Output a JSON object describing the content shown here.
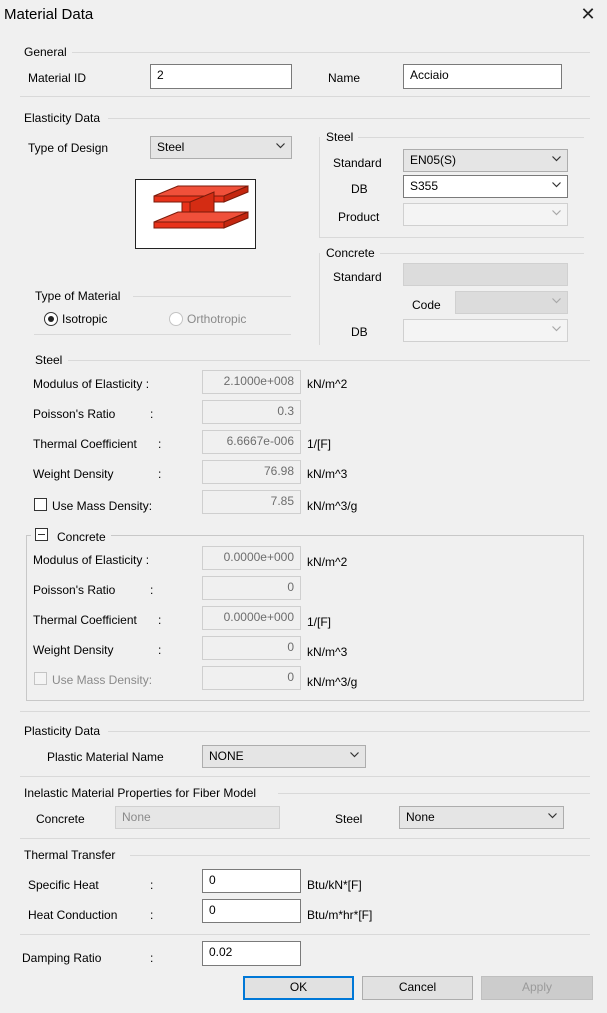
{
  "window": {
    "title": "Material Data"
  },
  "general": {
    "label": "General",
    "material_id_label": "Material ID",
    "material_id": "2",
    "name_label": "Name",
    "name": "Acciaio"
  },
  "elasticity": {
    "label": "Elasticity Data",
    "type_of_design_label": "Type of Design",
    "type_of_design": "Steel",
    "type_of_material": {
      "label": "Type of Material",
      "isotropic": "Isotropic",
      "orthotropic": "Orthotropic",
      "selected": "Isotropic"
    },
    "steel_group": {
      "label": "Steel",
      "standard_label": "Standard",
      "standard": "EN05(S)",
      "db_label": "DB",
      "db": "S355",
      "product_label": "Product",
      "product": ""
    },
    "concrete_group": {
      "label": "Concrete",
      "standard_label": "Standard",
      "standard": "",
      "code_label": "Code",
      "code": "",
      "db_label": "DB",
      "db": ""
    }
  },
  "steel_props": {
    "label": "Steel",
    "rows": [
      {
        "label": "Modulus of Elasticity :",
        "value": "2.1000e+008",
        "unit": "kN/m^2"
      },
      {
        "label": "Poisson's Ratio",
        "value": "0.3",
        "unit": ""
      },
      {
        "label": "Thermal Coefficient",
        "value": "6.6667e-006",
        "unit": "1/[F]"
      },
      {
        "label": "Weight Density",
        "value": "76.98",
        "unit": "kN/m^3"
      }
    ],
    "mass_density": {
      "label": "Use Mass Density:",
      "value": "7.85",
      "unit": "kN/m^3/g",
      "checked": false
    }
  },
  "concrete_props": {
    "label": "Concrete",
    "rows": [
      {
        "label": "Modulus of Elasticity :",
        "value": "0.0000e+000",
        "unit": "kN/m^2"
      },
      {
        "label": "Poisson's Ratio",
        "value": "0",
        "unit": ""
      },
      {
        "label": "Thermal Coefficient",
        "value": "0.0000e+000",
        "unit": "1/[F]"
      },
      {
        "label": "Weight Density",
        "value": "0",
        "unit": "kN/m^3"
      }
    ],
    "mass_density": {
      "label": "Use Mass Density:",
      "value": "0",
      "unit": "kN/m^3/g",
      "checked": false
    }
  },
  "plasticity": {
    "label": "Plasticity Data",
    "material_name_label": "Plastic Material Name",
    "material_name": "NONE"
  },
  "inelastic": {
    "label": "Inelastic Material Properties for Fiber Model",
    "concrete_label": "Concrete",
    "concrete": "None",
    "steel_label": "Steel",
    "steel": "None"
  },
  "thermal": {
    "label": "Thermal Transfer",
    "specific_heat_label": "Specific Heat",
    "specific_heat": "0",
    "specific_heat_unit": "Btu/kN*[F]",
    "heat_conduction_label": "Heat Conduction",
    "heat_conduction": "0",
    "heat_conduction_unit": "Btu/m*hr*[F]"
  },
  "damping": {
    "label": "Damping Ratio",
    "value": "0.02"
  },
  "colon": ":",
  "buttons": {
    "ok": "OK",
    "cancel": "Cancel",
    "apply": "Apply"
  },
  "colors": {
    "accent": "#0078d7",
    "beam_red": "#e8321a",
    "beam_outline": "#7a1a0a"
  }
}
